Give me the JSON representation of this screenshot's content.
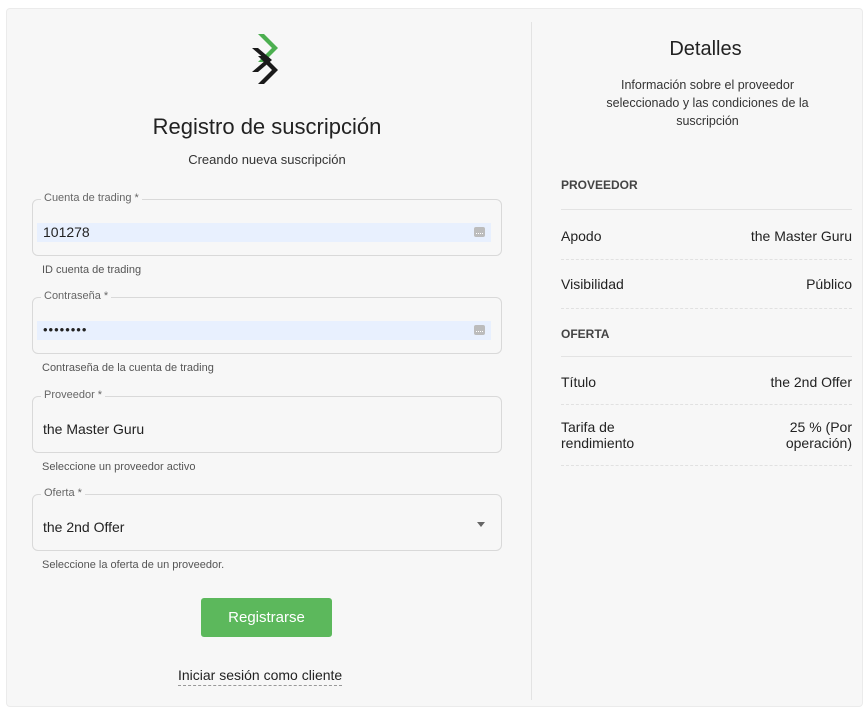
{
  "form": {
    "title": "Registro de suscripción",
    "subtitle": "Creando nueva suscripción",
    "trading_account": {
      "label": "Cuenta de trading *",
      "value": "101278",
      "help": "ID cuenta de trading"
    },
    "password": {
      "label": "Contraseña *",
      "value": "••••••••",
      "help": "Contraseña de la cuenta de trading"
    },
    "provider": {
      "label": "Proveedor *",
      "value": "the Master Guru",
      "help": "Seleccione un proveedor activo"
    },
    "offer": {
      "label": "Oferta *",
      "value": "the 2nd Offer",
      "help": "Seleccione la oferta de un proveedor."
    },
    "submit_label": "Registrarse",
    "client_login_link": "Iniciar sesión como cliente"
  },
  "details": {
    "title": "Detalles",
    "description": "Información sobre el proveedor seleccionado y las condiciones de la suscripción",
    "provider_section": "PROVEEDOR",
    "nickname_label": "Apodo",
    "nickname_value": "the Master Guru",
    "visibility_label": "Visibilidad",
    "visibility_value": "Público",
    "offer_section": "OFERTA",
    "offer_title_label": "Título",
    "offer_title_value": "the 2nd Offer",
    "fee_label_1": "Tarifa de",
    "fee_label_2": "rendimiento",
    "fee_value_1": "25 % (Por",
    "fee_value_2": "operación)"
  },
  "colors": {
    "accent_green": "#5cb85c",
    "autofill_blue": "#e8f0fe",
    "logo_green": "#4caf50",
    "logo_dark": "#1a1a1a"
  }
}
